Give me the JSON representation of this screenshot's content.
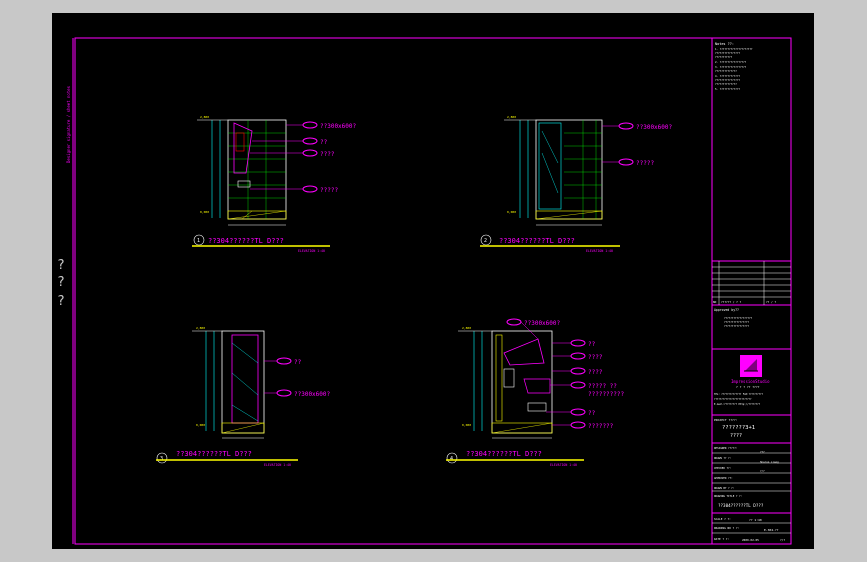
{
  "left_margin": {
    "vertical_text": "Designer signature / sheet notes",
    "question_marks": [
      "?",
      "?",
      "?"
    ]
  },
  "notes": {
    "title": "Notes ??:",
    "lines": [
      "1. ?????????????????????",
      "   ????????????????",
      "   ???????????",
      "2. ?????????????????",
      "3. ?????????????????",
      "   ??????????????",
      "4. ?????????????",
      "   ????????????????",
      "   ??????????????",
      "5. ?????????????"
    ]
  },
  "elevations": [
    {
      "id": "elev-1",
      "title": "??304??????TL D???",
      "number": "1",
      "scale": "ELEVATION 1:40",
      "height_labels": [
        "2,800",
        "0,000"
      ],
      "callouts": [
        "??300x600?",
        "??",
        "????",
        "?????"
      ]
    },
    {
      "id": "elev-2",
      "title": "??304??????TL D???",
      "number": "2",
      "scale": "ELEVATION 1:40",
      "height_labels": [
        "2,800",
        "0,000"
      ],
      "callouts": [
        "??300x600?",
        "?????"
      ]
    },
    {
      "id": "elev-3",
      "title": "??304??????TL D???",
      "number": "3",
      "scale": "ELEVATION 1:40",
      "height_labels": [
        "2,800",
        "0,000"
      ],
      "callouts": [
        "??",
        "??300x600?"
      ]
    },
    {
      "id": "elev-4",
      "title": "??304??????TL D???",
      "number": "4",
      "scale": "ELEVATION 1:40",
      "height_labels": [
        "2,800",
        "0,000"
      ],
      "callouts": [
        "??300x600?",
        "??",
        "????",
        "????",
        "????? ??",
        "??????????",
        "??",
        "???????"
      ]
    }
  ],
  "title_block": {
    "revision_header": [
      "NO",
      "?????? / ? ?",
      "?? / ?"
    ],
    "approved_label": "Approved by??",
    "approved_lines": [
      "??????????????????",
      "????????????????",
      "????????????????"
    ],
    "company_name": "ImpressionStudio",
    "company_sub": "? ? ?   ?? ????",
    "address_lines": [
      "TEL: ?????????????? FAX:??????????",
      "??????????????????????????",
      "E-mail:????????? Http://????????"
    ],
    "project_label": "PROJECT ????:",
    "project_name": "???????3+1",
    "project_sub": "????",
    "fields": [
      {
        "label": "DESIGNER ?????:",
        "value": "???"
      },
      {
        "label": "DRAWN ?? ?:",
        "value": "Sharon  Liang"
      },
      {
        "label": "CHECKED ??:",
        "value": "?/?"
      },
      {
        "label": "APPROVED ??:",
        "value": ""
      },
      {
        "label": "DRAWN BY ? ?:",
        "value": ""
      },
      {
        "label": "DRAWING TITLE ? ?:",
        "value": ""
      }
    ],
    "drawing_title": "??304??????TL D???",
    "scale_label": "SCALE ? ?:",
    "scale_value": "?? 1:40",
    "drawing_no_label": "DRAWING NO ? ?:",
    "drawing_no_value": "E-304-??",
    "date_label": "DATE ? ?:",
    "date_value": "2009.02.05",
    "rev_value": "?/?"
  }
}
